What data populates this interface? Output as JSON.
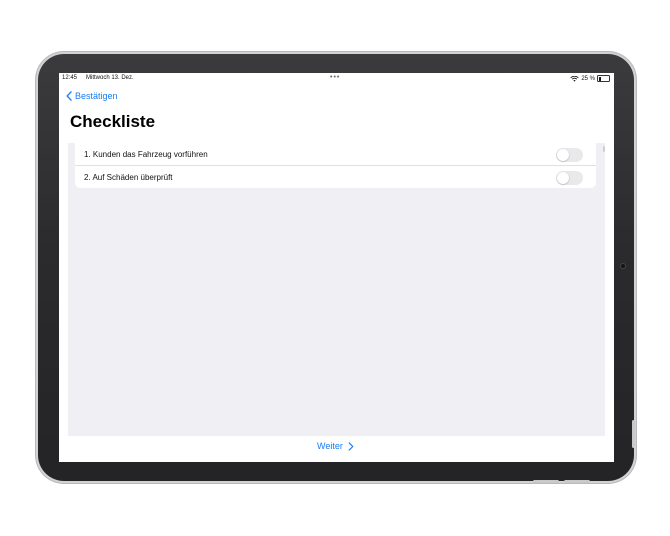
{
  "status_bar": {
    "time": "12:45",
    "date": "Mittwoch 13. Dez.",
    "multitask_dots": "•••",
    "battery_percent": "25 %",
    "battery_level": 0.25
  },
  "navigation": {
    "back_label": "Bestätigen"
  },
  "page": {
    "title": "Checkliste"
  },
  "checklist": [
    {
      "label": "1. Kunden das Fahrzeug vorführen",
      "enabled": false
    },
    {
      "label": "2. Auf Schäden überprüft",
      "enabled": false
    }
  ],
  "footer": {
    "next_label": "Weiter"
  },
  "colors": {
    "accent": "#1a7cf5",
    "background_grouped": "#efeff4",
    "toggle_off": "#e9e9eb"
  }
}
